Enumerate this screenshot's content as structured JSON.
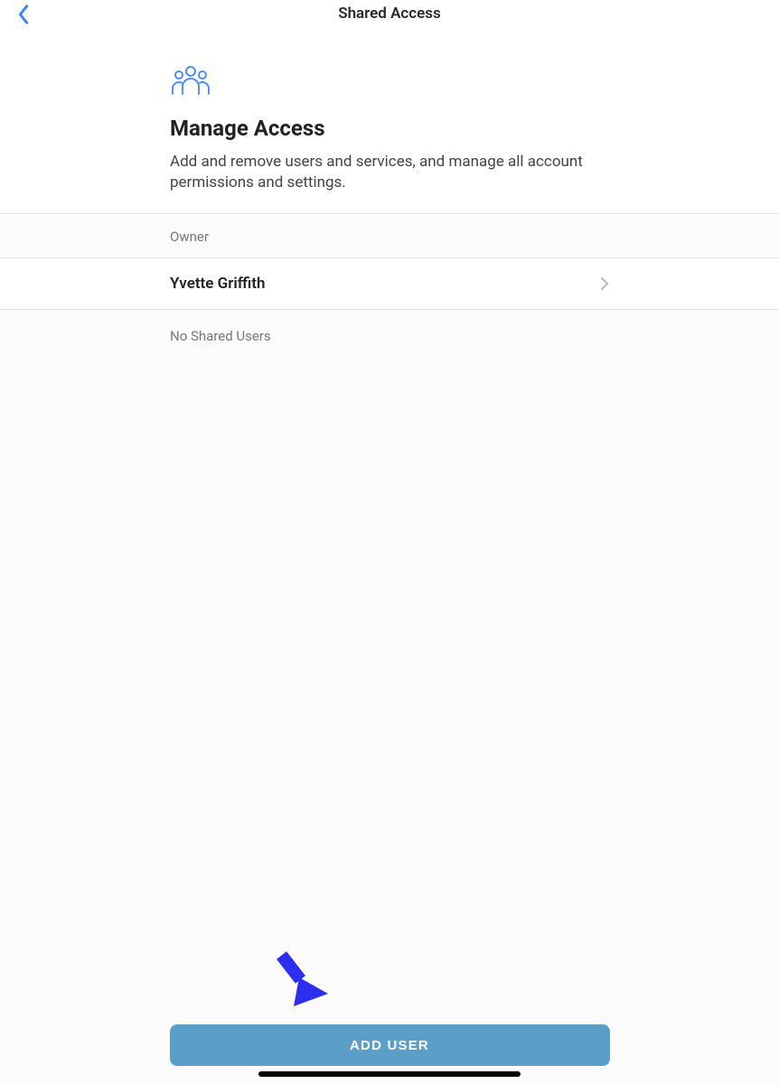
{
  "header": {
    "title": "Shared Access"
  },
  "manage": {
    "title": "Manage Access",
    "description": "Add and remove users and services, and manage all account permissions and settings."
  },
  "owner": {
    "section_label": "Owner",
    "name": "Yvette Griffith"
  },
  "shared_users": {
    "empty_text": "No Shared Users"
  },
  "actions": {
    "add_user_label": "ADD USER"
  },
  "colors": {
    "accent_blue": "#3a86ff",
    "button_blue": "#5b9fc9",
    "arrow_blue": "#2e2ef0"
  }
}
